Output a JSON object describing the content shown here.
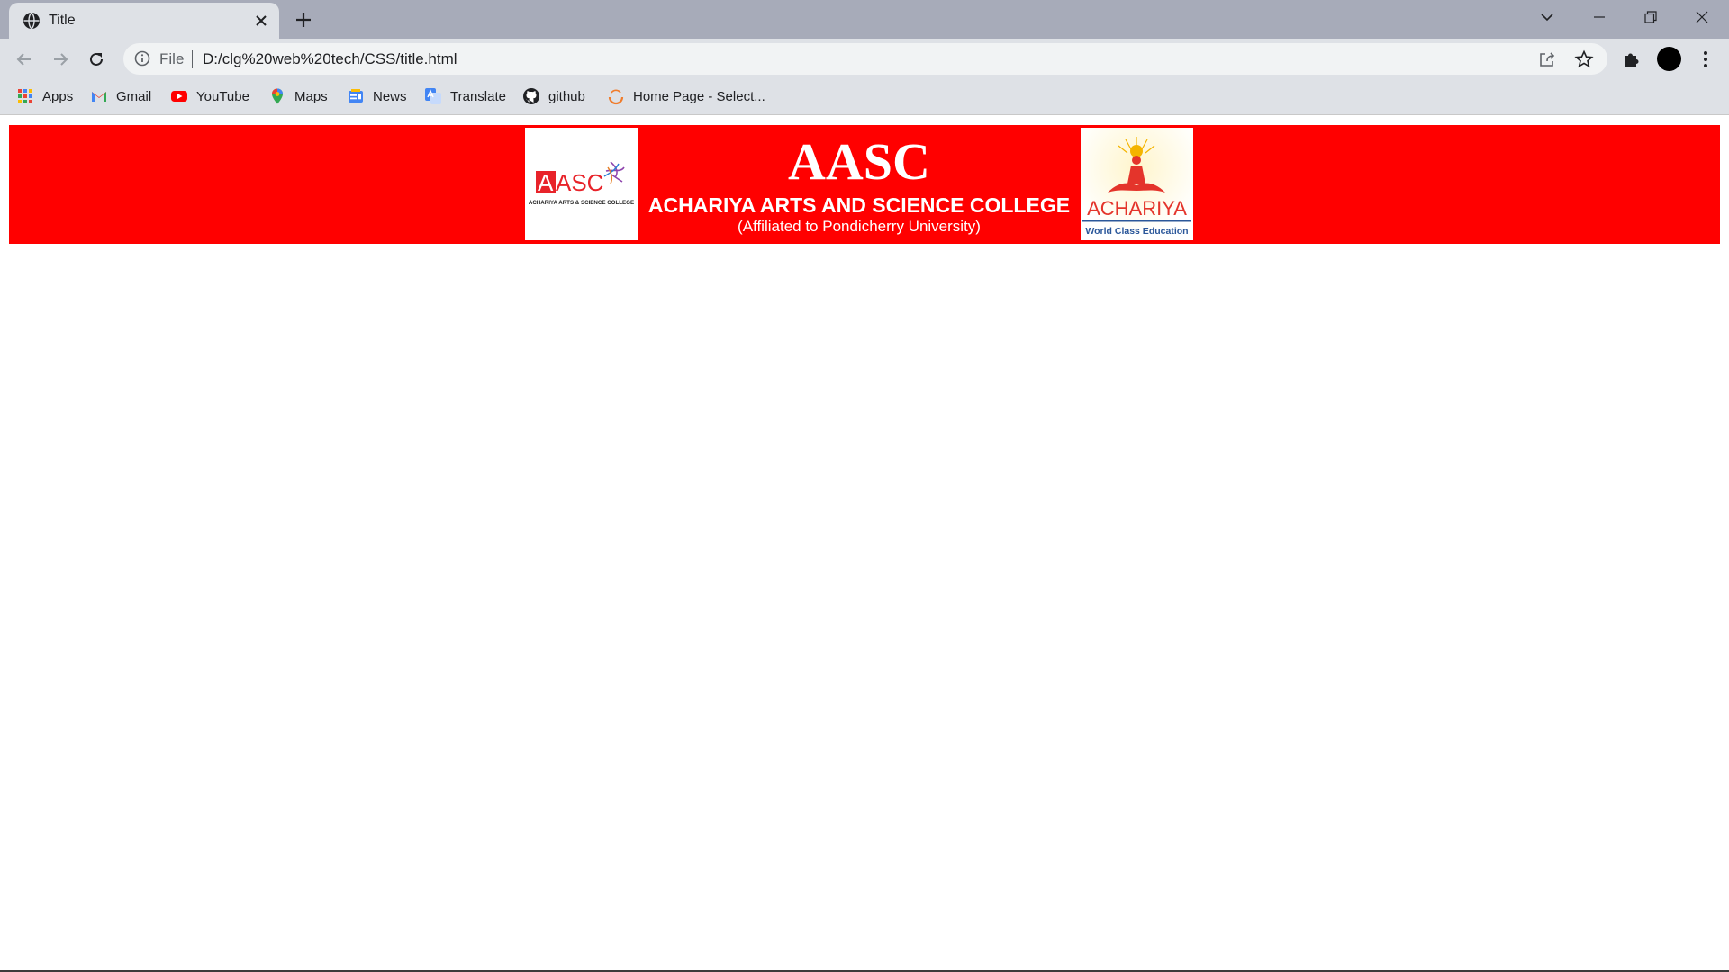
{
  "tab": {
    "title": "Title"
  },
  "toolbar": {
    "scheme": "File",
    "url": "D:/clg%20web%20tech/CSS/title.html"
  },
  "bookmarks": [
    {
      "label": "Apps",
      "icon": "apps-grid-icon"
    },
    {
      "label": "Gmail",
      "icon": "gmail-icon"
    },
    {
      "label": "YouTube",
      "icon": "youtube-icon"
    },
    {
      "label": "Maps",
      "icon": "maps-icon"
    },
    {
      "label": "News",
      "icon": "news-icon"
    },
    {
      "label": "Translate",
      "icon": "translate-icon"
    },
    {
      "label": "github",
      "icon": "github-icon"
    },
    {
      "label": "Home Page - Select...",
      "icon": "home-page-icon"
    }
  ],
  "banner": {
    "title": "AASC",
    "subtitle": "ACHARIYA ARTS AND SCIENCE COLLEGE",
    "affiliation": "(Affiliated to Pondicherry University)",
    "left_logo_text": "AASC",
    "left_logo_caption": "ACHARIYA ARTS & SCIENCE COLLEGE",
    "right_logo_text": "ACHARIYA",
    "right_logo_caption": "World Class Education",
    "background_color": "#ff0000"
  }
}
